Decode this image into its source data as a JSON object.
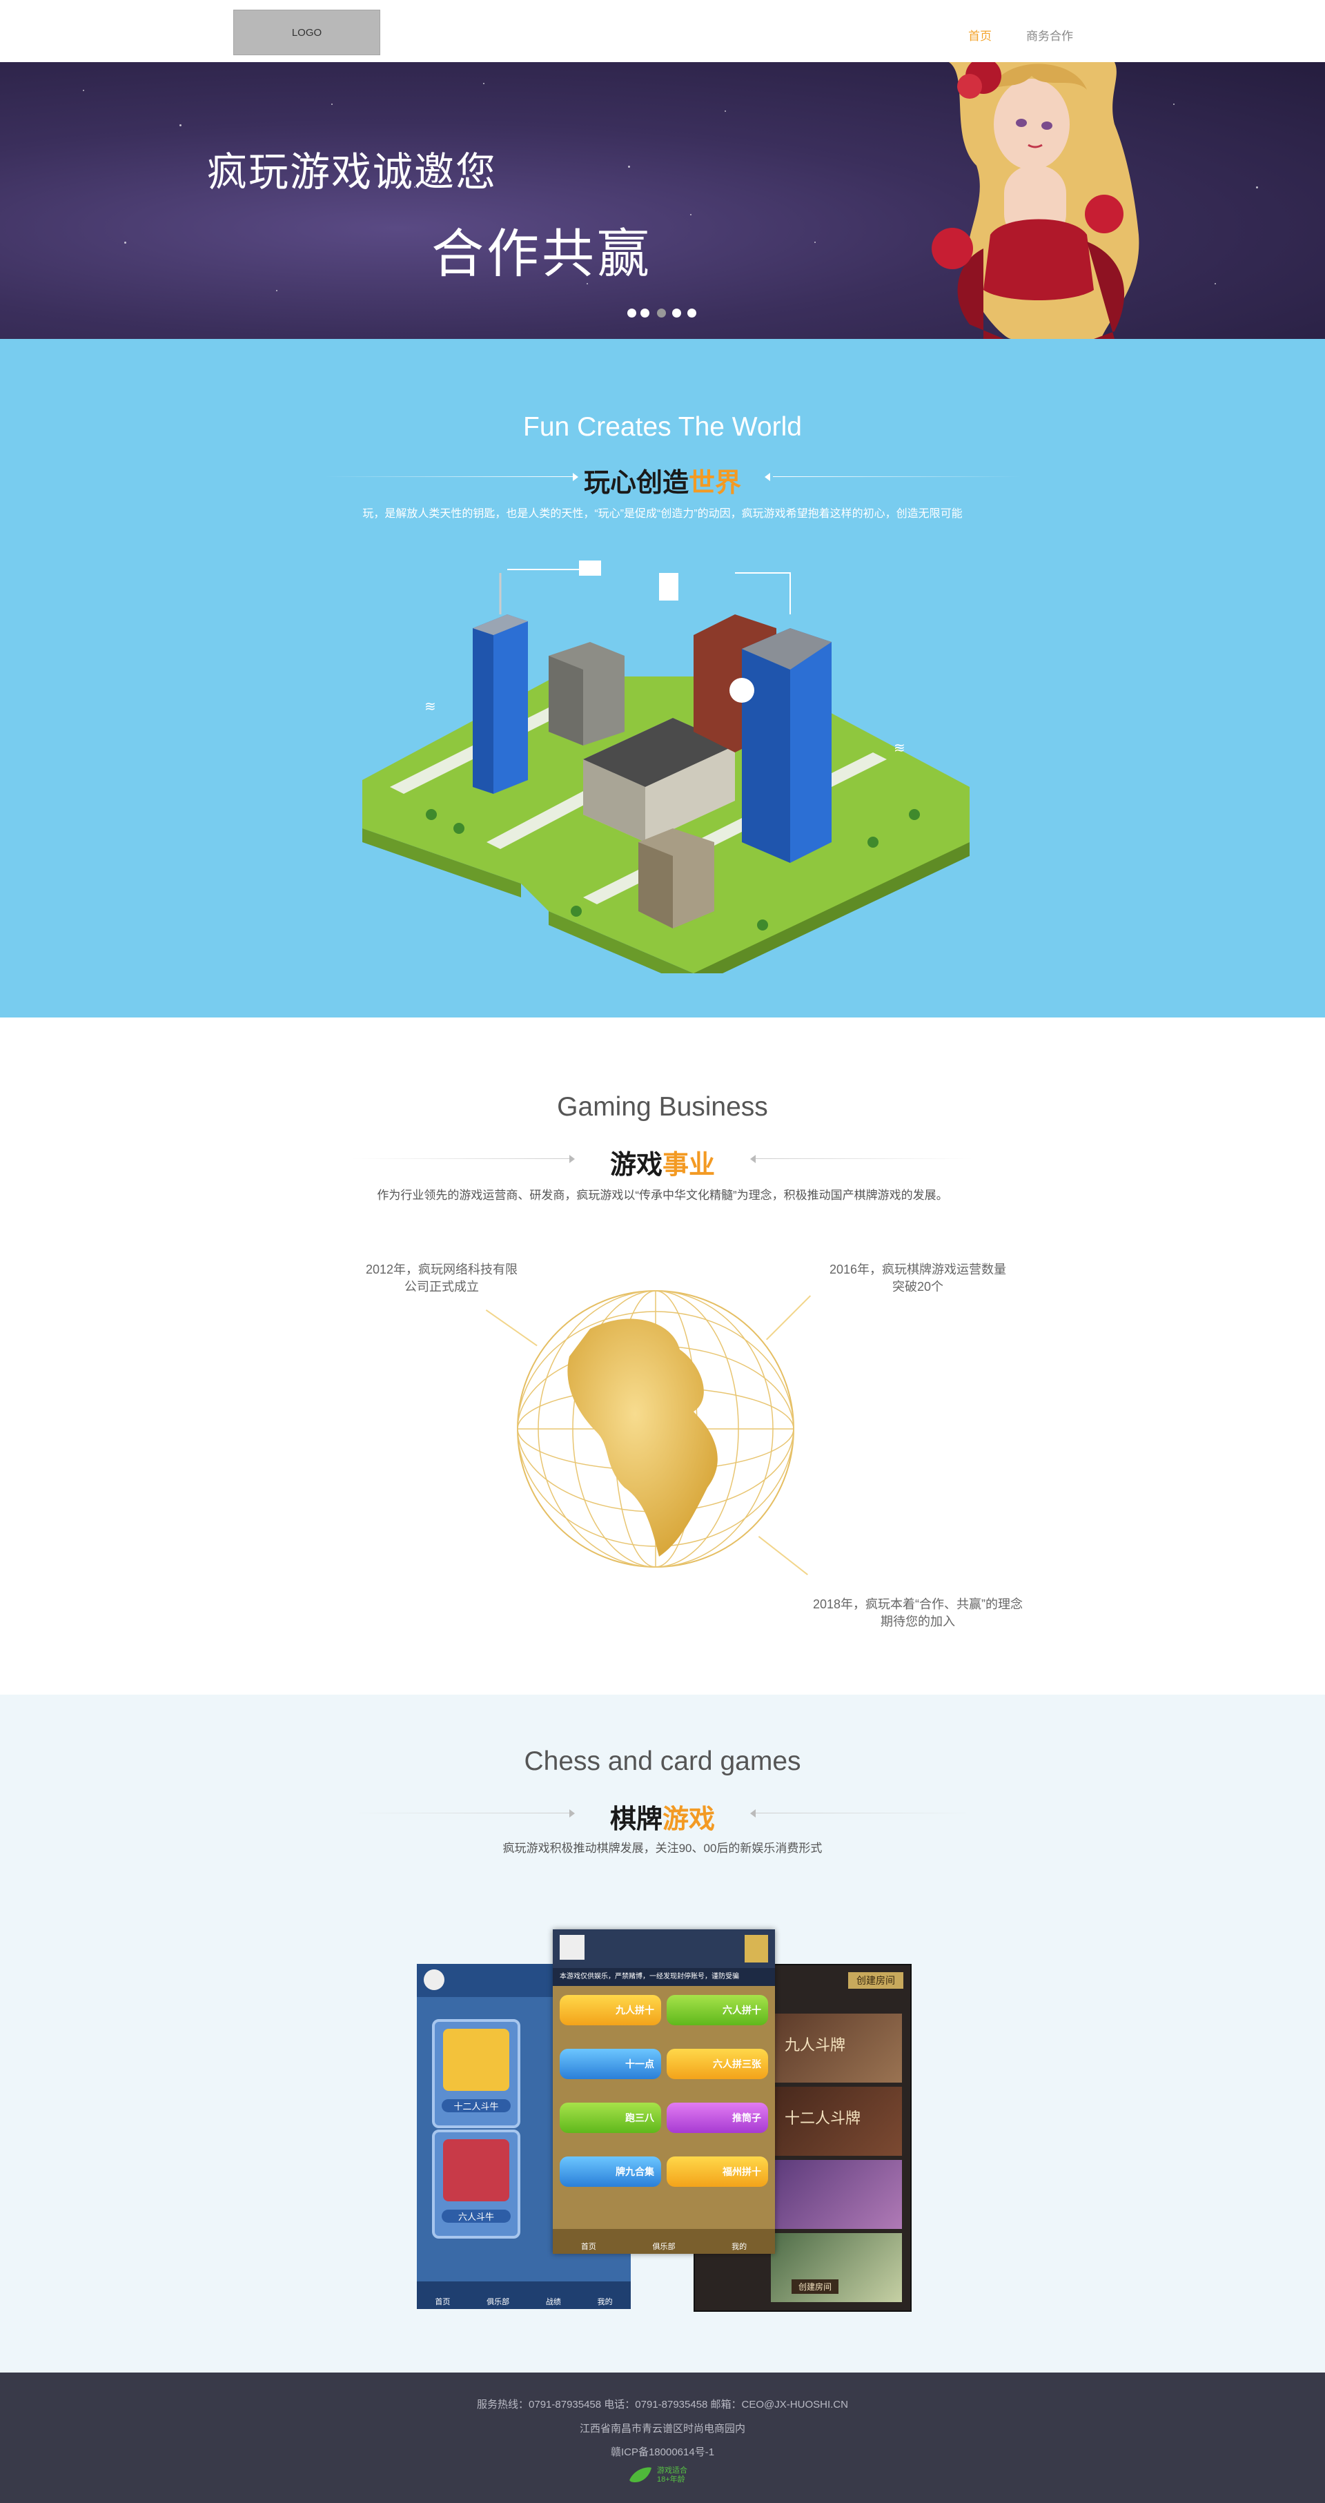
{
  "header": {
    "logo_text": "LOGO",
    "nav": [
      {
        "label": "首页",
        "active": true
      },
      {
        "label": "商务合作",
        "active": false
      }
    ],
    "active_color": "#f3a32b"
  },
  "banner": {
    "line1": "疯玩游戏诚邀您",
    "line2": "合作共赢",
    "slide_count": 5,
    "current_slide": 3
  },
  "world": {
    "title_en": "Fun Creates The World",
    "title_zh_a": "玩心创造",
    "title_zh_b": "世界",
    "desc": "玩，是解放人类天性的钥匙，也是人类的天性，“玩心”是促成“创造力”的动因，疯玩游戏希望抱着这样的初心，创造无限可能",
    "bg_color": "#78ccef"
  },
  "business": {
    "title_en": "Gaming Business",
    "title_zh_a": "游戏",
    "title_zh_b": "事业",
    "desc": "作为行业领先的游戏运营商、研发商，疯玩游戏以“传承中华文化精髓”为理念，积极推动国产棋牌游戏的发展。",
    "milestones": [
      {
        "line1": "2012年，疯玩网络科技有限",
        "line2": "公司正式成立"
      },
      {
        "line1": "2016年，疯玩棋牌游戏运营数量",
        "line2": "突破20个"
      },
      {
        "line1": "2018年，疯玩本着“合作、共赢”的理念",
        "line2": "期待您的加入"
      }
    ]
  },
  "chess": {
    "title_en": "Chess and card games",
    "title_zh_a": "棋牌",
    "title_zh_b": "游戏",
    "desc": "疯玩游戏积极推动棋牌发展，关注90、00后的新娱乐消费形式",
    "left_screen": {
      "tabs": [
        "首页",
        "俱乐部",
        "战绩",
        "我的"
      ],
      "games": [
        "十二人斗牛",
        "六人斗牛"
      ]
    },
    "center_screen": {
      "notice": "本游戏仅供娱乐，严禁赌博，一经发现封停账号，谨防受骗",
      "games": [
        "九人拼十",
        "六人拼十",
        "十一点",
        "六人拼三张",
        "跑三八",
        "推筒子",
        "牌九合集",
        "福州拼十"
      ],
      "tabs": [
        "首页",
        "俱乐部",
        "我的"
      ]
    },
    "right_screen": {
      "header": "创建房间",
      "rooms": [
        "九人斗牌",
        "十二人斗牌"
      ],
      "room_button": "创建房间"
    }
  },
  "footer": {
    "line1": "服务热线：0791-87935458 电话：0791-87935458  邮箱：CEO@JX-HUOSHI.CN",
    "line2": "江西省南昌市青云谱区时尚电商园内",
    "line3": "赣ICP备18000614号-1",
    "badge_line1": "游戏适合",
    "badge_line2": "18+年龄",
    "bg_color": "#393a49"
  }
}
